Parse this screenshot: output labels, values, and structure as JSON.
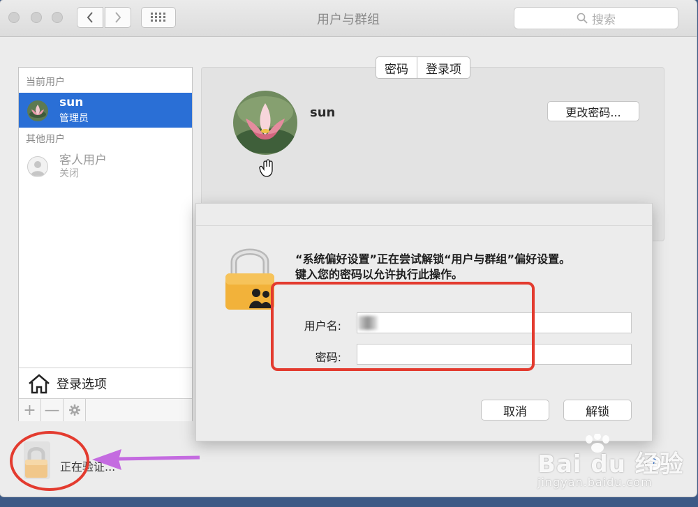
{
  "window": {
    "title": "用户与群组"
  },
  "search": {
    "placeholder": "搜索"
  },
  "sidebar": {
    "current_header": "当前用户",
    "current_user": {
      "name": "sun",
      "role": "管理员"
    },
    "other_header": "其他用户",
    "guest": {
      "name": "客人用户",
      "status": "关闭"
    },
    "login_options_label": "登录选项",
    "toolbar": {
      "add": "+",
      "remove": "—"
    }
  },
  "tabs": [
    {
      "label": "密码"
    },
    {
      "label": "登录项"
    }
  ],
  "main": {
    "username": "sun",
    "change_password_label": "更改密码..."
  },
  "dialog": {
    "message_line1": "“系统偏好设置”正在尝试解锁“用户与群组”偏好设置。",
    "message_line2": "键入您的密码以允许执行此操作。",
    "username_label": "用户名:",
    "password_label": "密码:",
    "username_value": "",
    "password_value": "",
    "cancel_label": "取消",
    "unlock_label": "解锁"
  },
  "status": {
    "unlocking_text": "正在验证...",
    "help": "?"
  },
  "watermark": {
    "main": "Bai du 经验",
    "sub": "jingyan.baidu.com"
  },
  "colors": {
    "selection": "#2a6fd6",
    "annotation": "#e33b2f",
    "arrow": "#c46be0"
  }
}
